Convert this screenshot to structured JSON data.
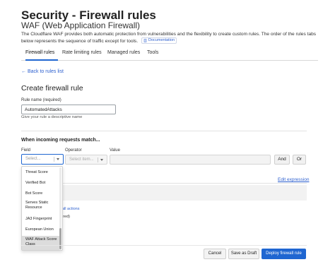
{
  "header": {
    "title": "Security - Firewall rules",
    "subtitle": "WAF (Web Application Firewall)",
    "description": "The Cloudflare WAF provides both automatic protection from vulnerabilities and the flexibility to create custom rules. The order of the rules tabs below represents the sequence of traffic except for tools.",
    "doc_link_label": "Documentation"
  },
  "tabs": [
    {
      "label": "Firewall rules",
      "active": true
    },
    {
      "label": "Rate limiting rules",
      "active": false
    },
    {
      "label": "Managed rules",
      "active": false
    },
    {
      "label": "Tools",
      "active": false
    }
  ],
  "back_link": "← Back to rules list",
  "form": {
    "heading": "Create firewall rule",
    "rule_name_label": "Rule name (required)",
    "rule_name_value": "AutomatedAttacks",
    "rule_name_help": "Give your rule a descriptive name",
    "match_heading": "When incoming requests match...",
    "field_label": "Field",
    "operator_label": "Operator",
    "value_label": "Value",
    "field_placeholder": "Select...",
    "operator_placeholder": "Select item...",
    "and_label": "And",
    "or_label": "Or",
    "edit_expression": "Edit expression",
    "fragment_actions": "all actions",
    "fragment_required": "ired)"
  },
  "dropdown": {
    "items": [
      {
        "label": "Threat Score",
        "selected": false
      },
      {
        "label": "Verified Bot",
        "selected": false
      },
      {
        "label": "Bot Score",
        "selected": false
      },
      {
        "label": "Serves Static Resource",
        "selected": false
      },
      {
        "label": "JA3 Fingerprint",
        "selected": false
      },
      {
        "label": "European Union",
        "selected": false
      },
      {
        "label": "WAF Attack Score Class",
        "selected": true
      }
    ]
  },
  "footer": {
    "cancel": "Cancel",
    "save_draft": "Save as Draft",
    "deploy": "Deploy firewall rule"
  },
  "colors": {
    "accent": "#1f66d1",
    "link": "#2c5fcf"
  }
}
